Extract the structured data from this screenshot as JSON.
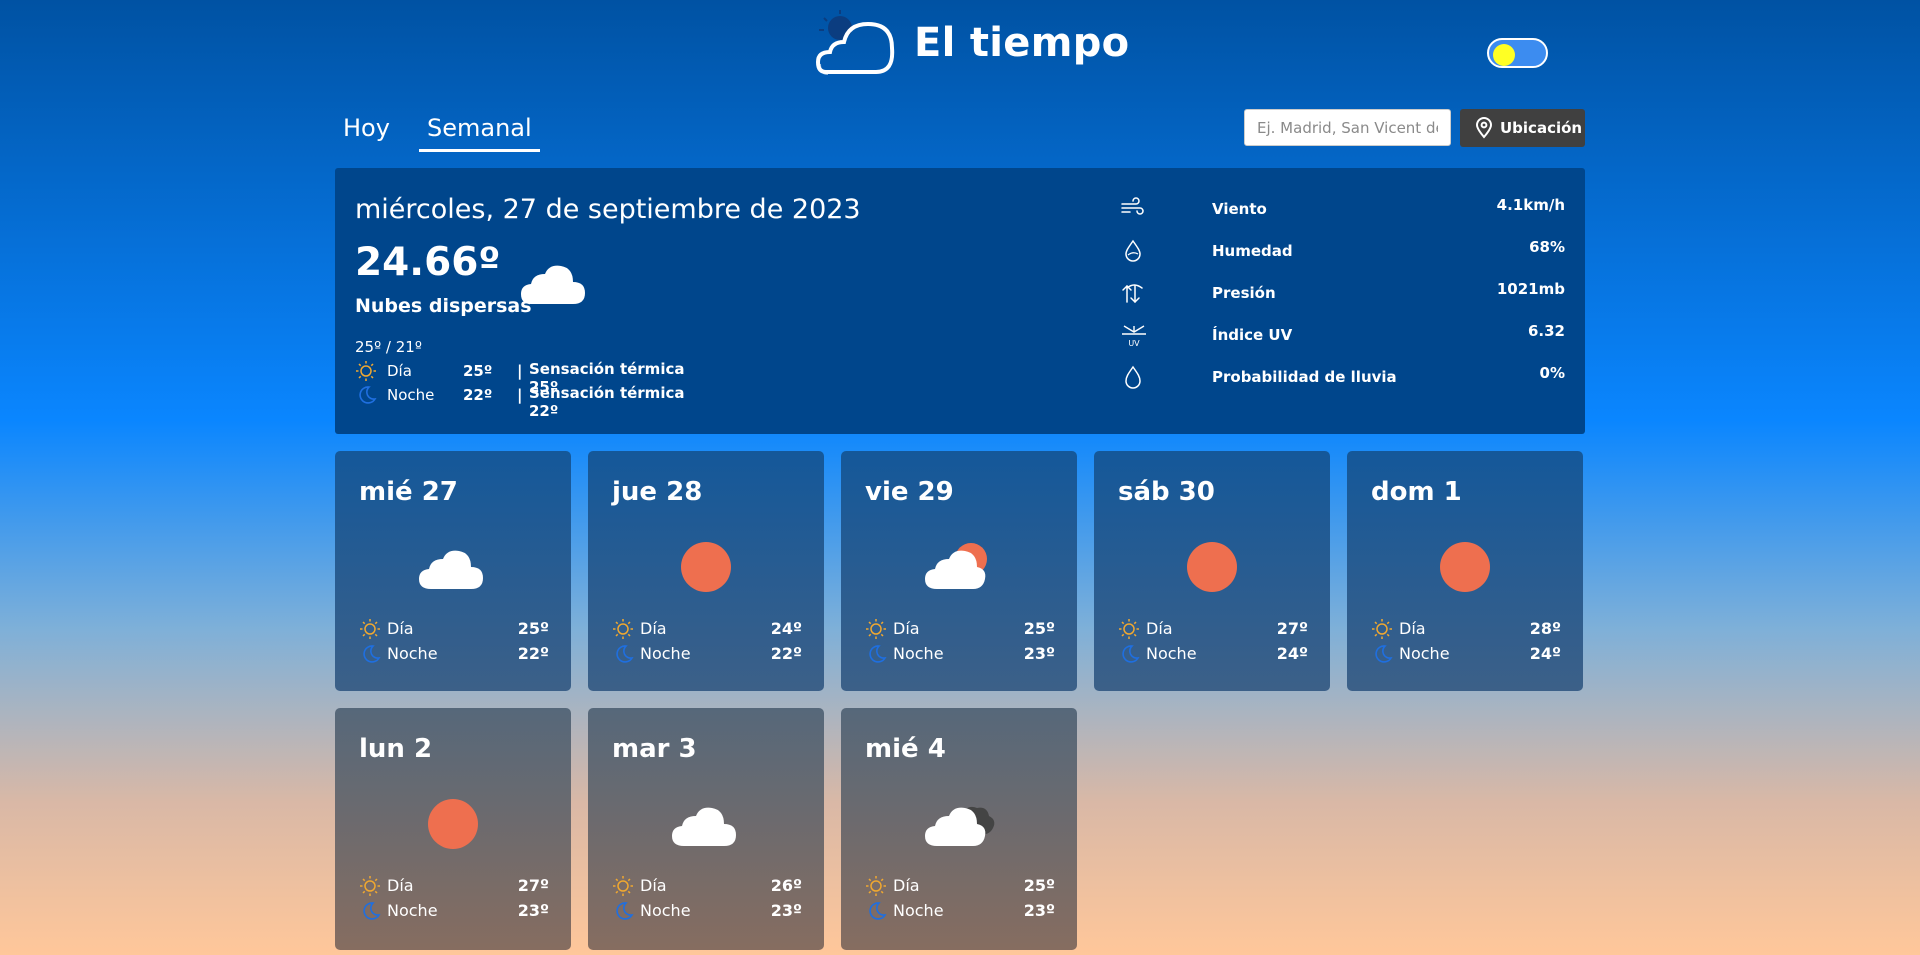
{
  "header": {
    "title": "El tiempo",
    "logo_icon": "cloud-logo-icon",
    "theme_toggle": "theme-toggle-switch"
  },
  "tabs": [
    {
      "label": "Hoy",
      "active": false
    },
    {
      "label": "Semanal",
      "active": true
    }
  ],
  "search": {
    "placeholder": "Ej. Madrid, San Vicent del Raspeig",
    "value": ""
  },
  "location_button": {
    "label": "Ubicación",
    "icon": "location-pin-icon"
  },
  "today": {
    "date": "miércoles, 27 de septiembre de 2023",
    "temperature": "24.66º",
    "description": "Nubes dispersas",
    "range": "25º / 21º",
    "day_label": "Día",
    "day_temp": "25º",
    "day_feel": "Sensación térmica 25º",
    "night_label": "Noche",
    "night_temp": "22º",
    "night_feel": "Sensación térmica 22º",
    "separator": "|",
    "metrics": [
      {
        "label": "Viento",
        "value": "4.1km/h",
        "icon": "wind-icon"
      },
      {
        "label": "Humedad",
        "value": "68%",
        "icon": "humidity-drop-icon"
      },
      {
        "label": "Presión",
        "value": "1021mb",
        "icon": "pressure-icon"
      },
      {
        "label": "Índice UV",
        "value": "6.32",
        "icon": "uv-icon"
      },
      {
        "label": "Probabilidad de lluvia",
        "value": "0%",
        "icon": "rain-drop-icon"
      }
    ]
  },
  "forecast": [
    {
      "day": "mié 27",
      "icon": "cloud-icon",
      "day_label": "Día",
      "day_temp": "25º",
      "night_label": "Noche",
      "night_temp": "22º"
    },
    {
      "day": "jue 28",
      "icon": "sun-icon",
      "day_label": "Día",
      "day_temp": "24º",
      "night_label": "Noche",
      "night_temp": "22º"
    },
    {
      "day": "vie 29",
      "icon": "sun-behind-cloud-icon",
      "day_label": "Día",
      "day_temp": "25º",
      "night_label": "Noche",
      "night_temp": "23º"
    },
    {
      "day": "sáb 30",
      "icon": "sun-icon",
      "day_label": "Día",
      "day_temp": "27º",
      "night_label": "Noche",
      "night_temp": "24º"
    },
    {
      "day": "dom 1",
      "icon": "sun-icon",
      "day_label": "Día",
      "day_temp": "28º",
      "night_label": "Noche",
      "night_temp": "24º"
    },
    {
      "day": "lun 2",
      "icon": "sun-icon",
      "day_label": "Día",
      "day_temp": "27º",
      "night_label": "Noche",
      "night_temp": "23º"
    },
    {
      "day": "mar 3",
      "icon": "cloud-icon",
      "day_label": "Día",
      "day_temp": "26º",
      "night_label": "Noche",
      "night_temp": "23º"
    },
    {
      "day": "mié 4",
      "icon": "broken-clouds-icon",
      "day_label": "Día",
      "day_temp": "25º",
      "night_label": "Noche",
      "night_temp": "23º"
    }
  ],
  "colors": {
    "sun": "#ee6f4f",
    "toggle_knob": "#ffff24",
    "card_today": "#00468c",
    "sun_outline": "#f0a830",
    "moon_outline": "#1f6fe0"
  }
}
